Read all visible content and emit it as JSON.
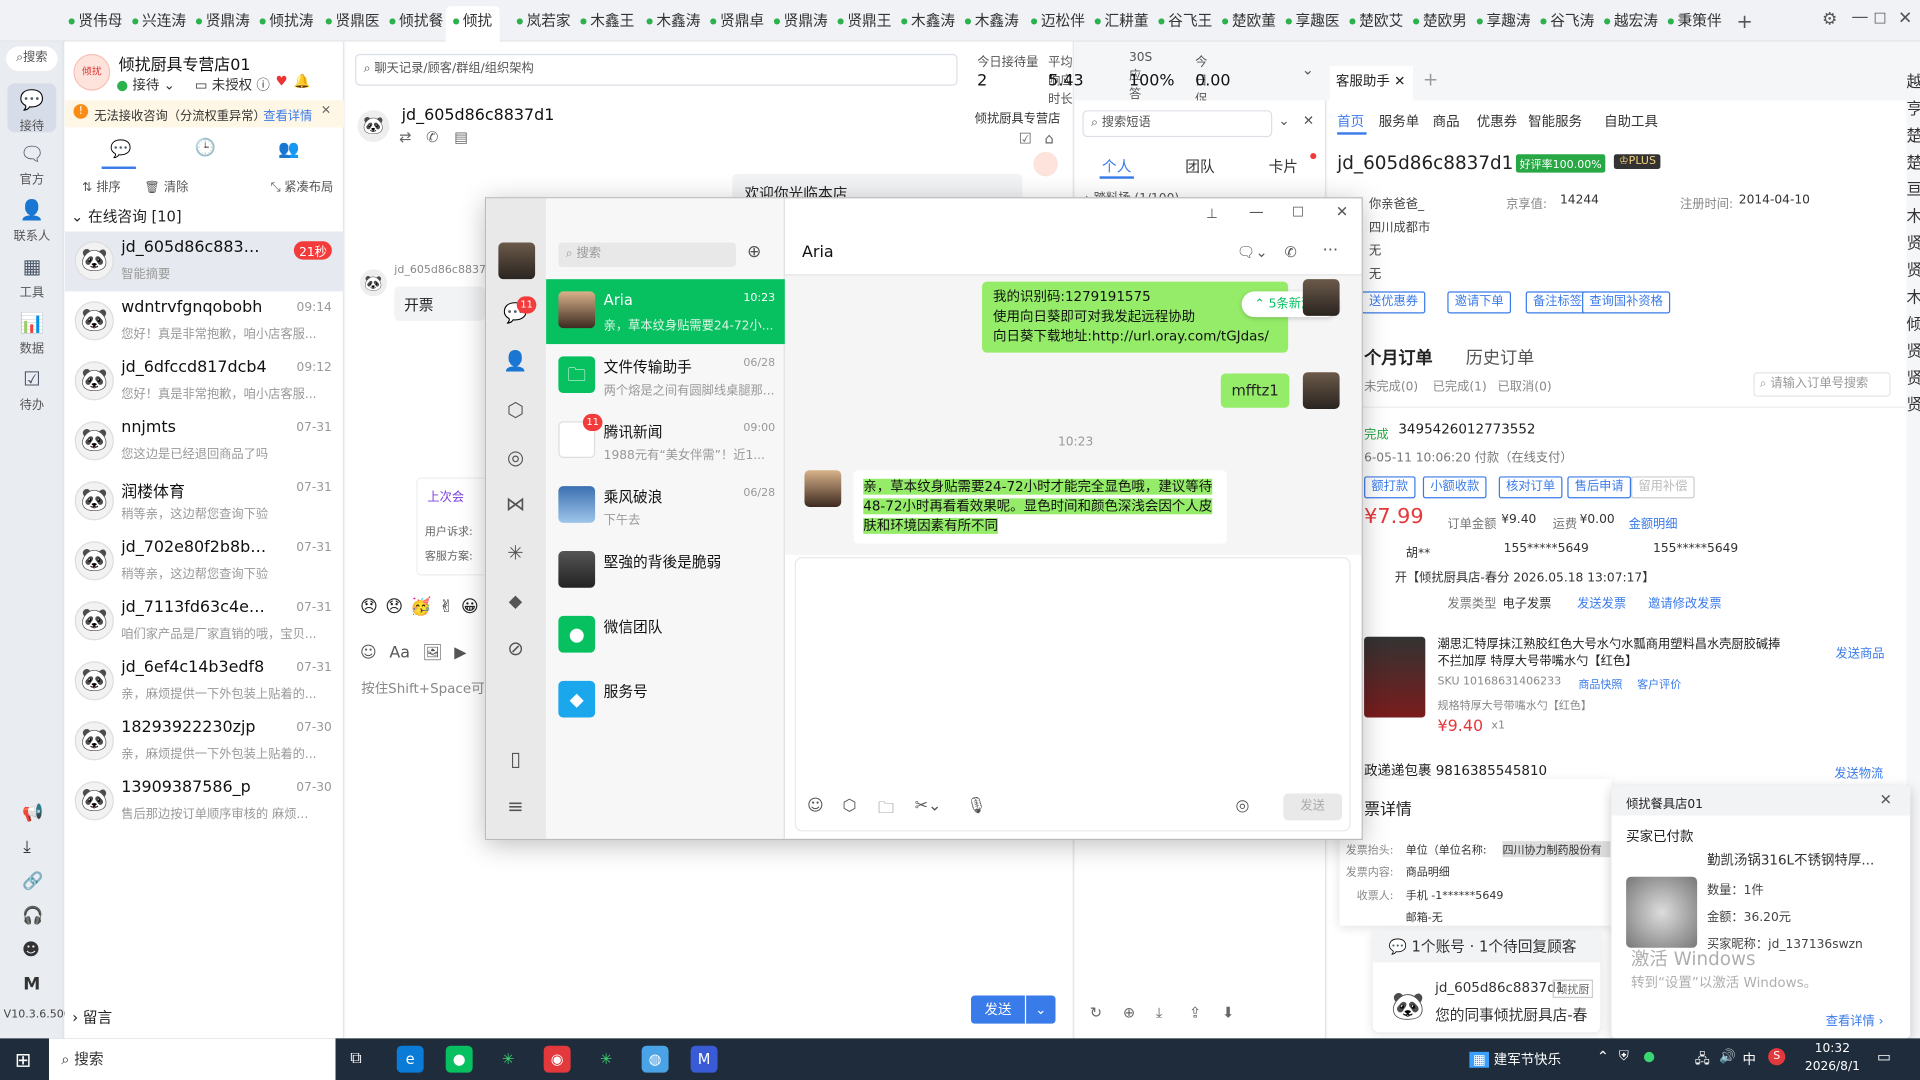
{
  "colors": {
    "accent": "#3a7bea",
    "wechat_green": "#07c160",
    "red": "#f43b3b",
    "orange": "#ff6a00"
  },
  "top_tabs": [
    "贤伟母",
    "兴连涛",
    "贤鼎涛",
    "倾扰涛",
    "贤鼎医",
    "倾扰餐",
    "倾扰",
    "岚若家",
    "木鑫王",
    "木鑫涛",
    "贤鼎卓",
    "贤鼎涛",
    "贤鼎王",
    "木鑫涛",
    "木鑫涛",
    "迈松伴",
    "汇耕董",
    "谷飞王",
    "楚欧董",
    "享趣医",
    "楚欧艾",
    "楚欧男",
    "享趣涛",
    "谷飞涛",
    "越宏涛",
    "秉策伴"
  ],
  "top_tab_active": "倾扰",
  "rail": {
    "search": "搜索",
    "items": [
      "接待",
      "官方",
      "联系人",
      "工具",
      "数据",
      "待办"
    ],
    "version": "V10.3.6.500"
  },
  "store": {
    "name": "倾扰厨具专营店01",
    "status": "接待",
    "auth": "未授权"
  },
  "warning": {
    "text": "无法接收咨询（分流权重异常）",
    "link": "查看详情"
  },
  "list_tools": {
    "sort": "排序",
    "clear": "清除",
    "compact": "紧凑布局"
  },
  "online_header": "在线咨询 [10]",
  "conversations": [
    {
      "name": "jd_605d86c8837d1",
      "time": "21秒",
      "preview": "智能摘要"
    },
    {
      "name": "wdntrvfgnqobobh",
      "time": "09:14",
      "preview": "您好！真是非常抱歉，咱小店客服..."
    },
    {
      "name": "jd_6dfccd817dcb4",
      "time": "09:12",
      "preview": "您好！真是非常抱歉，咱小店客服..."
    },
    {
      "name": "nnjmts",
      "time": "07-31",
      "preview": "您这边是已经退回商品了吗"
    },
    {
      "name": "润楼体育",
      "time": "07-31",
      "preview": "稍等亲，这边帮您查询下验"
    },
    {
      "name": "jd_702e80f2b8b19",
      "time": "07-31",
      "preview": "稍等亲，这边帮您查询下验"
    },
    {
      "name": "jd_7113fd63c4e85",
      "time": "07-31",
      "preview": "咱们家产品是厂家直销的哦，宝贝..."
    },
    {
      "name": "jd_6ef4c14b3edf8",
      "time": "07-31",
      "preview": "亲，麻烦提供一下外包装上贴着的..."
    },
    {
      "name": "18293922230zjp",
      "time": "07-30",
      "preview": "亲，麻烦提供一下外包装上贴着的..."
    },
    {
      "name": "13909387586_p",
      "time": "07-30",
      "preview": "售后那边按订单顺序审核的 麻烦..."
    }
  ],
  "leave_msg": "留言",
  "chat": {
    "search_placeholder": "聊天记录/顾客/群组/组织架构",
    "stats": [
      {
        "label": "今日接待量",
        "value": "2"
      },
      {
        "label": "平均响应时长",
        "value": "5.43"
      },
      {
        "label": "30S应答率",
        "value": "100%"
      },
      {
        "label": "今日促成下单金额",
        "value": "0.00"
      }
    ],
    "user": "jd_605d86c8837d1",
    "store_tag": "倾扰厨具专营店",
    "welcome": "欢迎你光临本店",
    "msg_sender": "jd_605d86c8837",
    "msg": "开票",
    "last_session": "上次会",
    "user_req": "用户诉求:",
    "cs_plan": "客服方案:",
    "input_hint": "按住Shift+Space可",
    "send": "发送"
  },
  "shortcuts": {
    "search": "搜索短语",
    "tabs": [
      "个人",
      "团队",
      "卡片"
    ],
    "group": "踏料场 (1/100)"
  },
  "wechat": {
    "search": "搜索",
    "title": "Aria",
    "chats": [
      {
        "name": "Aria",
        "time": "10:23",
        "preview": "亲，草本纹身贴需要24-72小..."
      },
      {
        "name": "文件传输助手",
        "time": "06/28",
        "preview": "两个熔是之间有圆脚线桌腿那..."
      },
      {
        "name": "腾讯新闻",
        "time": "09:00",
        "preview": "1988元有“美女伴需”！近1..."
      },
      {
        "name": "乘风破浪",
        "time": "06/28",
        "preview": "下午去"
      },
      {
        "name": "堅強的背後是脆弱",
        "time": "",
        "preview": ""
      },
      {
        "name": "微信团队",
        "time": "",
        "preview": ""
      },
      {
        "name": "服务号",
        "time": "",
        "preview": ""
      }
    ],
    "badge_chat": "11",
    "badge_news": "11",
    "msg1": [
      "我的识别码:1279191575",
      "使用向日葵即可对我发起远程协助",
      "向日葵下载地址:http://url.oray.com/tGJdas/"
    ],
    "new_msgs": "5条新消息",
    "msg2": "mfftz1",
    "time": "10:23",
    "msg3": "亲，草本纹身贴需要24-72小时才能完全显色哦，建议等待48-72小时再看看效果呢。显色时间和颜色深浅会因个人皮肤和环境因素有所不同",
    "send": "发送"
  },
  "assistant": {
    "tab": "客服助手",
    "nav": [
      "首页",
      "服务单",
      "商品",
      "优惠券",
      "智能服务",
      "自助工具"
    ],
    "user": "jd_605d86c8837d1",
    "praise": "好评率100.00%",
    "plus": "PLUS",
    "nick_label": "你亲爸爸_",
    "jd_label": "京享值:",
    "jd_value": "14244",
    "reg_label": "注册时间:",
    "reg_value": "2014-04-10",
    "region": "四川成都市",
    "none1": "无",
    "none2": "无",
    "btns": [
      "送优惠券",
      "邀请下单",
      "备注标签",
      "查询国补资格"
    ],
    "order_tabs": [
      "个月订单",
      "历史订单"
    ],
    "order_filters": [
      "未完成(0)",
      "已完成(1)",
      "已取消(0)"
    ],
    "order_search": "请输入订单号搜索",
    "order_status": "完成",
    "order_no": "3495426012773552",
    "order_time": "6-05-11 10:06:20 付款（在线支付）",
    "order_btns": [
      "额打款",
      "小额收款",
      "核对订单",
      "售后申请",
      "留用补偿"
    ],
    "price": "¥7.99",
    "order_amount_label": "订单金额",
    "order_amount": "¥9.40",
    "shipping_label": "运费",
    "shipping": "¥0.00",
    "detail_link": "金额明细",
    "buyer": "胡**",
    "phone": "155*****5649",
    "remark": "开【倾扰厨具店-春分 2026.05.18 13:07:17】",
    "invoice_type_label": "发票类型",
    "invoice_type": "电子发票",
    "send_invoice": "发送发票",
    "invite_invoice": "邀请修改发票",
    "product_title": "潮思汇特厚抹江熟胶红色大号水勺水瓢商用塑料昌水壳厨胶碱捧不拦加厚 特厚大号带嘴水勺【红色】",
    "sku": "SKU 10168631406233",
    "snapshot": "商品快照",
    "review": "客户评价",
    "spec": "规格特厚大号带嘴水勺【红色】",
    "product_price": "¥9.40",
    "qty": "x1",
    "send_product": "发送商品",
    "package": "政递递包裹 9816385545810",
    "send_logistics": "发送物流",
    "invoice_title": "票详情",
    "inv_head_label": "发票抬头:",
    "inv_head": "单位（单位名称:",
    "inv_company": "四川协力制药股份有",
    "inv_content_label": "发票内容:",
    "inv_content": "商品明细",
    "receiver_label": "收票人:",
    "receiver": "手机 -1******5649",
    "mail": "邮箱-无",
    "pending": "1个账号 · 1个待回复顾客",
    "pending_user": "jd_605d86c8837d1",
    "pending_store": "倾扰厨",
    "pending_msg": "您的同事倾扰厨具店-春",
    "side_text": [
      "越",
      "亨",
      "楚",
      "楚",
      "亘",
      "木",
      "贤",
      "贤",
      "木",
      "倾",
      "贤",
      "贤",
      "贤"
    ]
  },
  "popup": {
    "title": "倾扰餐具店01",
    "status": "买家已付款",
    "product": "勤凯汤锅316L不锈钢特厚...",
    "qty": "数量：1件",
    "amount": "金额：36.20元",
    "buyer": "买家昵称：jd_137136swzn",
    "link": "查看详情",
    "activate": "激活 Windows",
    "activate_sub": "转到“设置”以激活 Windows。"
  },
  "taskbar": {
    "search": "搜索",
    "weather": "建军节快乐",
    "time": "10:32",
    "date": "2026/8/1",
    "ime": "中"
  }
}
